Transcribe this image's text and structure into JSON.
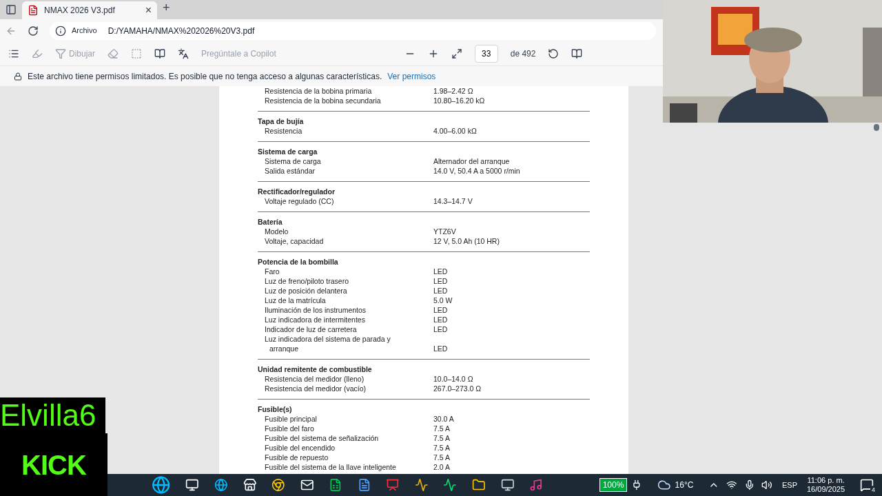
{
  "tab": {
    "title": "NMAX 2026 V3.pdf",
    "close": "×",
    "new": "+"
  },
  "address": {
    "badge": "Archivo",
    "url": "D:/YAMAHA/NMAX%202026%20V3.pdf"
  },
  "toolbar": {
    "draw": {
      "label": "Dibujar",
      "disabled": true
    },
    "copilot": {
      "label": "Pregúntale a Copilot",
      "disabled": true
    },
    "page": "33",
    "total": "de 492"
  },
  "banner": {
    "text": "Este archivo tiene permisos limitados. Es posible que no tenga acceso a algunas características.",
    "link": "Ver permisos"
  },
  "sections": [
    {
      "rows": [
        [
          "Resistencia de la bobina primaria",
          "1.98–2.42 Ω"
        ],
        [
          "Resistencia de la bobina secundaria",
          "10.80–16.20 kΩ"
        ]
      ]
    },
    {
      "heading": "Tapa de bujía",
      "rows": [
        [
          "Resistencia",
          "4.00–6.00 kΩ"
        ]
      ]
    },
    {
      "heading": "Sistema de carga",
      "rows": [
        [
          "Sistema de carga",
          "Alternador del arranque"
        ],
        [
          "Salida estándar",
          "14.0 V, 50.4 A a 5000 r/min"
        ]
      ]
    },
    {
      "heading": "Rectificador/regulador",
      "rows": [
        [
          "Voltaje regulado (CC)",
          "14.3–14.7 V"
        ]
      ]
    },
    {
      "heading": "Batería",
      "rows": [
        [
          "Modelo",
          "YTZ6V"
        ],
        [
          "Voltaje, capacidad",
          "12 V, 5.0 Ah (10 HR)"
        ]
      ]
    },
    {
      "heading": "Potencia de la bombilla",
      "rows": [
        [
          "Faro",
          "LED"
        ],
        [
          "Luz de freno/piloto trasero",
          "LED"
        ],
        [
          "Luz de posición delantera",
          "LED"
        ],
        [
          "Luz de la matrícula",
          "5.0 W"
        ],
        [
          "Iluminación de los instrumentos",
          "LED"
        ],
        [
          "Luz indicadora de intermitentes",
          "LED"
        ],
        [
          "Indicador de luz de carretera",
          "LED"
        ],
        [
          "Luz indicadora del sistema de parada y arranque",
          "LED"
        ]
      ]
    },
    {
      "heading": "Unidad remitente de combustible",
      "rows": [
        [
          "Resistencia del medidor (lleno)",
          "10.0–14.0 Ω"
        ],
        [
          "Resistencia del medidor (vacío)",
          "267.0–273.0 Ω"
        ]
      ]
    },
    {
      "heading": "Fusible(s)",
      "rows": [
        [
          "Fusible principal",
          "30.0 A"
        ],
        [
          "Fusible del faro",
          "7.5 A"
        ],
        [
          "Fusible del sistema de señalización",
          "7.5 A"
        ],
        [
          "Fusible del encendido",
          "7.5 A"
        ],
        [
          "Fusible de repuesto",
          "7.5 A"
        ],
        [
          "Fusible del sistema de la llave inteligente",
          "2.0 A"
        ]
      ]
    }
  ],
  "overlay": {
    "name": "Elvilla6",
    "logo": "KICK"
  },
  "taskbar": {
    "battery": "100%",
    "weather": "16°C",
    "language": "ESP",
    "time": "11:06 p. m.",
    "date": "16/09/2025",
    "notifications": "4"
  }
}
